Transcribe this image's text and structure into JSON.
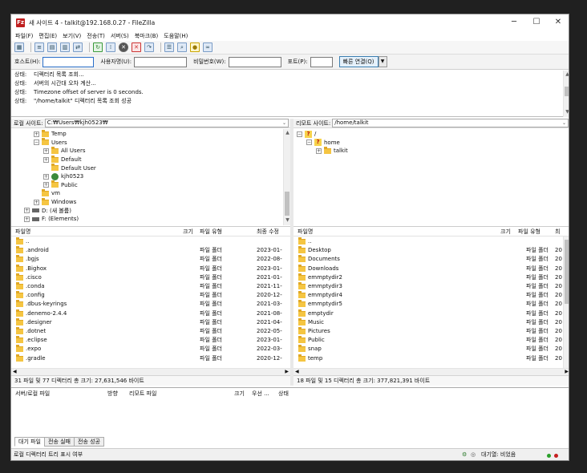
{
  "window": {
    "title": "새 사이트 4 - talkit@192.168.0.27 - FileZilla",
    "min": "─",
    "max": "☐",
    "close": "✕"
  },
  "menu": [
    "파일(F)",
    "편집(E)",
    "보기(V)",
    "전송(T)",
    "서버(S)",
    "북마크(B)",
    "도움말(H)"
  ],
  "quickconnect": {
    "host_label": "호스트(H):",
    "user_label": "사용자명(U):",
    "pass_label": "비밀번호(W):",
    "port_label": "포트(P):",
    "connect": "빠른 연결(Q)",
    "host": "",
    "user": "",
    "pass": "",
    "port": ""
  },
  "log": [
    {
      "k": "상태:",
      "v": "디렉터리 목록 조회..."
    },
    {
      "k": "상태:",
      "v": "서버의 시간대 오차 계산..."
    },
    {
      "k": "상태:",
      "v": "Timezone offset of server is 0 seconds."
    },
    {
      "k": "상태:",
      "v": "\"/home/talkit\" 디렉터리 목록 조회 성공"
    }
  ],
  "local": {
    "label": "로컬 사이트:",
    "path": "C:₩Users₩kjh0523₩",
    "tree": [
      {
        "name": "Temp",
        "lvl": 2,
        "exp": "+",
        "icon": "folder"
      },
      {
        "name": "Users",
        "lvl": 2,
        "exp": "-",
        "icon": "folder"
      },
      {
        "name": "All Users",
        "lvl": 3,
        "exp": "+",
        "icon": "folder"
      },
      {
        "name": "Default",
        "lvl": 3,
        "exp": "+",
        "icon": "folder"
      },
      {
        "name": "Default User",
        "lvl": 3,
        "exp": "",
        "icon": "folder"
      },
      {
        "name": "kjh0523",
        "lvl": 3,
        "exp": "+",
        "icon": "user"
      },
      {
        "name": "Public",
        "lvl": 3,
        "exp": "+",
        "icon": "folder"
      },
      {
        "name": "vm",
        "lvl": 2,
        "exp": "",
        "icon": "folder"
      },
      {
        "name": "Windows",
        "lvl": 2,
        "exp": "+",
        "icon": "folder"
      },
      {
        "name": "D: (새 볼륨)",
        "lvl": 1,
        "exp": "+",
        "icon": "drive"
      },
      {
        "name": "F: (Elements)",
        "lvl": 1,
        "exp": "+",
        "icon": "drive"
      }
    ],
    "headers": {
      "name": "파일명",
      "size": "크기",
      "type": "파일 유형",
      "modified": "최종 수정"
    },
    "files": [
      {
        "name": "..",
        "type": "",
        "date": ""
      },
      {
        "name": ".android",
        "type": "파일 폴더",
        "date": "2023-01-"
      },
      {
        "name": ".bgjs",
        "type": "파일 폴더",
        "date": "2022-08-"
      },
      {
        "name": ".Bighox",
        "type": "파일 폴더",
        "date": "2023-01-"
      },
      {
        "name": ".cisco",
        "type": "파일 폴더",
        "date": "2021-01-"
      },
      {
        "name": ".conda",
        "type": "파일 폴더",
        "date": "2021-11-"
      },
      {
        "name": ".config",
        "type": "파일 폴더",
        "date": "2020-12-"
      },
      {
        "name": ".dbus-keyrings",
        "type": "파일 폴더",
        "date": "2021-03-"
      },
      {
        "name": ".denemo-2.4.4",
        "type": "파일 폴더",
        "date": "2021-08-"
      },
      {
        "name": ".designer",
        "type": "파일 폴더",
        "date": "2021-04-"
      },
      {
        "name": ".dotnet",
        "type": "파일 폴더",
        "date": "2022-05-"
      },
      {
        "name": ".eclipse",
        "type": "파일 폴더",
        "date": "2023-01-"
      },
      {
        "name": ".expo",
        "type": "파일 폴더",
        "date": "2022-03-"
      },
      {
        "name": ".gradle",
        "type": "파일 폴더",
        "date": "2020-12-"
      }
    ],
    "status": "31 파일 및 77 디렉터리 총 크기: 27,631,546 바이트"
  },
  "remote": {
    "label": "리모트 사이트:",
    "path": "/home/talkit",
    "tree": [
      {
        "name": "/",
        "lvl": 0,
        "exp": "-",
        "icon": "q"
      },
      {
        "name": "home",
        "lvl": 1,
        "exp": "-",
        "icon": "q"
      },
      {
        "name": "talkit",
        "lvl": 2,
        "exp": "+",
        "icon": "folder"
      }
    ],
    "headers": {
      "name": "파일명",
      "size": "크기",
      "type": "파일 유형",
      "modified": "최"
    },
    "files": [
      {
        "name": "..",
        "type": "",
        "date": ""
      },
      {
        "name": "Desktop",
        "type": "파일 폴더",
        "date": "20"
      },
      {
        "name": "Documents",
        "type": "파일 폴더",
        "date": "20"
      },
      {
        "name": "Downloads",
        "type": "파일 폴더",
        "date": "20"
      },
      {
        "name": "emmptydir2",
        "type": "파일 폴더",
        "date": "20"
      },
      {
        "name": "emmptydir3",
        "type": "파일 폴더",
        "date": "20"
      },
      {
        "name": "emmptydir4",
        "type": "파일 폴더",
        "date": "20"
      },
      {
        "name": "emmptydir5",
        "type": "파일 폴더",
        "date": "20"
      },
      {
        "name": "emptydir",
        "type": "파일 폴더",
        "date": "20"
      },
      {
        "name": "Music",
        "type": "파일 폴더",
        "date": "20"
      },
      {
        "name": "Pictures",
        "type": "파일 폴더",
        "date": "20"
      },
      {
        "name": "Public",
        "type": "파일 폴더",
        "date": "20"
      },
      {
        "name": "snap",
        "type": "파일 폴더",
        "date": "20"
      },
      {
        "name": "temp",
        "type": "파일 폴더",
        "date": "20"
      }
    ],
    "status": "18 파일 및 15 디렉터리 총 크기: 377,821,391 바이트"
  },
  "queue": {
    "headers": [
      "서버/로컬 파일",
      "방향",
      "리모트 파일",
      "크기",
      "우선 ...",
      "상태"
    ],
    "tabs": [
      "대기 파일",
      "전송 실패",
      "전송 성공"
    ]
  },
  "statusbar": {
    "left": "로컬 디렉터리 트리 표시 여부",
    "queue": "대기열: 비었음"
  }
}
